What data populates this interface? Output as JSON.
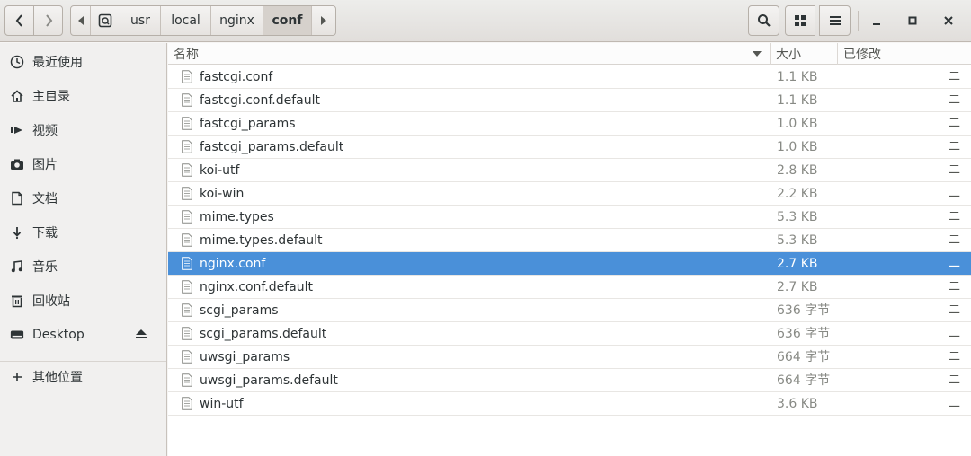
{
  "header": {
    "path": [
      "usr",
      "local",
      "nginx",
      "conf"
    ],
    "active_crumb": "conf"
  },
  "sidebar": {
    "items": [
      {
        "label": "最近使用",
        "icon": "clock-icon"
      },
      {
        "label": "主目录",
        "icon": "home-icon"
      },
      {
        "label": "视频",
        "icon": "video-icon"
      },
      {
        "label": "图片",
        "icon": "camera-icon"
      },
      {
        "label": "文档",
        "icon": "document-icon"
      },
      {
        "label": "下载",
        "icon": "download-icon"
      },
      {
        "label": "音乐",
        "icon": "music-icon"
      },
      {
        "label": "回收站",
        "icon": "trash-icon"
      },
      {
        "label": "Desktop",
        "icon": "drive-icon"
      },
      {
        "label": "其他位置",
        "icon": "plus-icon"
      }
    ]
  },
  "columns": {
    "name": "名称",
    "size": "大小",
    "modified": "已修改"
  },
  "files": [
    {
      "name": "fastcgi.conf",
      "size": "1.1 KB",
      "modified": "二"
    },
    {
      "name": "fastcgi.conf.default",
      "size": "1.1 KB",
      "modified": "二"
    },
    {
      "name": "fastcgi_params",
      "size": "1.0 KB",
      "modified": "二"
    },
    {
      "name": "fastcgi_params.default",
      "size": "1.0 KB",
      "modified": "二"
    },
    {
      "name": "koi-utf",
      "size": "2.8 KB",
      "modified": "二"
    },
    {
      "name": "koi-win",
      "size": "2.2 KB",
      "modified": "二"
    },
    {
      "name": "mime.types",
      "size": "5.3 KB",
      "modified": "二"
    },
    {
      "name": "mime.types.default",
      "size": "5.3 KB",
      "modified": "二"
    },
    {
      "name": "nginx.conf",
      "size": "2.7 KB",
      "modified": "二",
      "selected": true
    },
    {
      "name": "nginx.conf.default",
      "size": "2.7 KB",
      "modified": "二"
    },
    {
      "name": "scgi_params",
      "size": "636 字节",
      "modified": "二"
    },
    {
      "name": "scgi_params.default",
      "size": "636 字节",
      "modified": "二"
    },
    {
      "name": "uwsgi_params",
      "size": "664 字节",
      "modified": "二"
    },
    {
      "name": "uwsgi_params.default",
      "size": "664 字节",
      "modified": "二"
    },
    {
      "name": "win-utf",
      "size": "3.6 KB",
      "modified": "二"
    }
  ],
  "colors": {
    "selection": "#4a90d9",
    "accent_text": "#ffffff"
  }
}
